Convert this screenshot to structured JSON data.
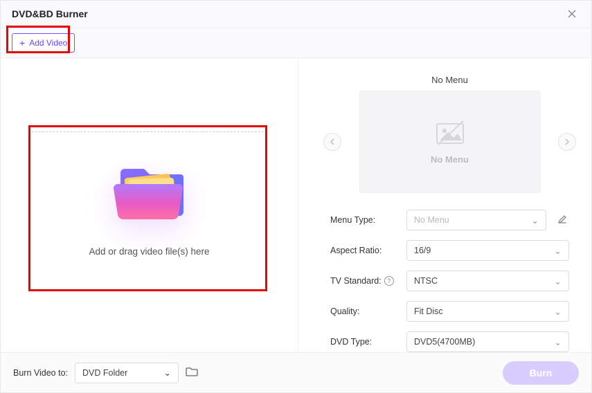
{
  "window": {
    "title": "DVD&BD Burner"
  },
  "toolbar": {
    "add_video_label": "Add Video"
  },
  "dropzone": {
    "hint": "Add or drag video file(s) here"
  },
  "preview": {
    "title": "No Menu",
    "placeholder_label": "No Menu"
  },
  "fields": {
    "menu_type": {
      "label": "Menu Type:",
      "value": "No Menu"
    },
    "aspect_ratio": {
      "label": "Aspect Ratio:",
      "value": "16/9"
    },
    "tv_standard": {
      "label": "TV Standard:",
      "value": "NTSC"
    },
    "quality": {
      "label": "Quality:",
      "value": "Fit Disc"
    },
    "dvd_type": {
      "label": "DVD Type:",
      "value": "DVD5(4700MB)"
    }
  },
  "footer": {
    "burn_to_label": "Burn Video to:",
    "burn_to_value": "DVD Folder",
    "burn_button": "Burn"
  }
}
